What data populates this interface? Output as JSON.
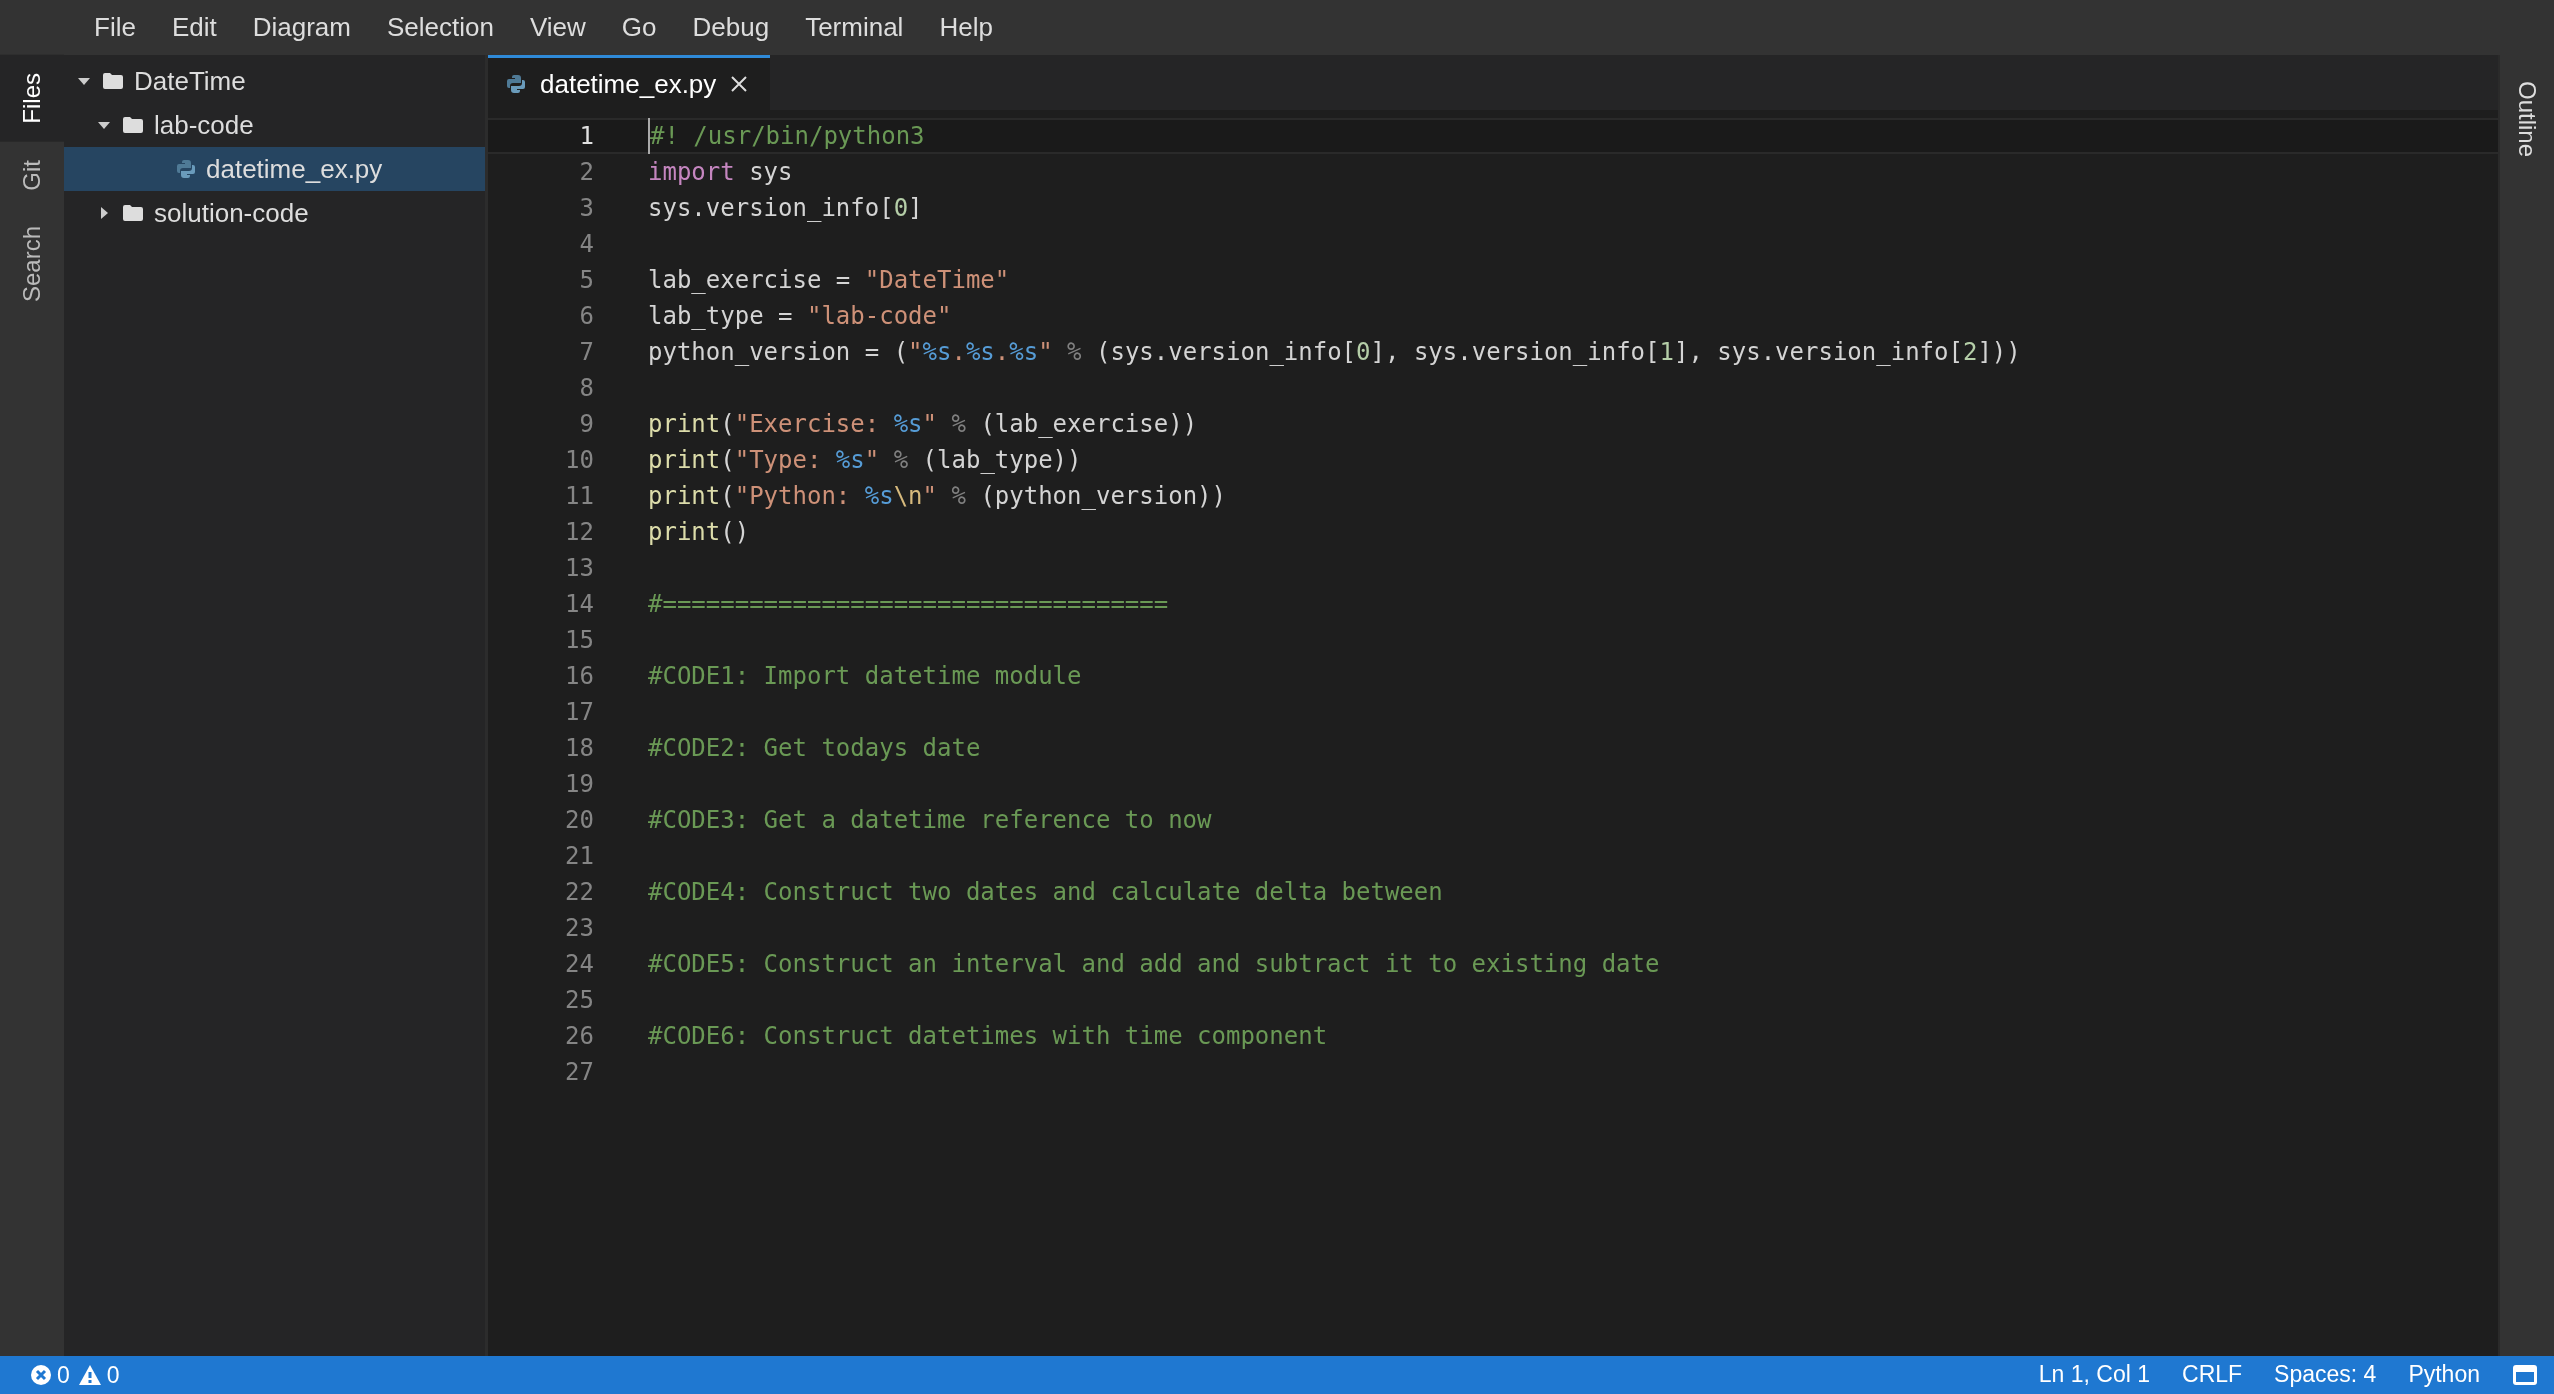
{
  "menu": [
    "File",
    "Edit",
    "Diagram",
    "Selection",
    "View",
    "Go",
    "Debug",
    "Terminal",
    "Help"
  ],
  "activity_tabs": [
    {
      "label": "Files",
      "selected": true
    },
    {
      "label": "Git",
      "selected": false
    },
    {
      "label": "Search",
      "selected": false
    }
  ],
  "tree": [
    {
      "label": "DateTime",
      "kind": "folder",
      "expanded": true,
      "selected": false,
      "children": [
        {
          "label": "lab-code",
          "kind": "folder",
          "expanded": true,
          "selected": false,
          "children": [
            {
              "label": "datetime_ex.py",
              "kind": "file",
              "selected": true
            }
          ]
        },
        {
          "label": "solution-code",
          "kind": "folder",
          "expanded": false,
          "selected": false
        }
      ]
    }
  ],
  "editor_tabs": [
    {
      "label": "datetime_ex.py",
      "selected": true
    }
  ],
  "code_lines": [
    {
      "number": "1",
      "current": true,
      "tokens": [
        {
          "text": "#! /usr/bin/python3",
          "kind": "comment"
        }
      ]
    },
    {
      "number": "2",
      "current": false,
      "tokens": [
        {
          "text": "import",
          "kind": "keyword"
        },
        {
          "text": " sys",
          "kind": "plain"
        }
      ]
    },
    {
      "number": "3",
      "current": false,
      "tokens": [
        {
          "text": "sys.version_info[",
          "kind": "plain"
        },
        {
          "text": "0",
          "kind": "number"
        },
        {
          "text": "]",
          "kind": "plain"
        }
      ]
    },
    {
      "number": "4",
      "current": false
    },
    {
      "number": "5",
      "current": false,
      "tokens": [
        {
          "text": "lab_exercise = ",
          "kind": "plain"
        },
        {
          "text": "\"DateTime\"",
          "kind": "string"
        }
      ]
    },
    {
      "number": "6",
      "current": false,
      "tokens": [
        {
          "text": "lab_type = ",
          "kind": "plain"
        },
        {
          "text": "\"lab-code\"",
          "kind": "string"
        }
      ]
    },
    {
      "number": "7",
      "current": false,
      "tokens": [
        {
          "text": "python_version = (",
          "kind": "plain"
        },
        {
          "text": "\"",
          "kind": "string"
        },
        {
          "text": "%s",
          "kind": "format"
        },
        {
          "text": ".",
          "kind": "string"
        },
        {
          "text": "%s",
          "kind": "format"
        },
        {
          "text": ".",
          "kind": "string"
        },
        {
          "text": "%s",
          "kind": "format"
        },
        {
          "text": "\"",
          "kind": "string"
        },
        {
          "text": " % ",
          "kind": "op"
        },
        {
          "text": "(sys.version_info[",
          "kind": "plain"
        },
        {
          "text": "0",
          "kind": "number"
        },
        {
          "text": "], sys.version_info[",
          "kind": "plain"
        },
        {
          "text": "1",
          "kind": "number"
        },
        {
          "text": "], sys.version_info[",
          "kind": "plain"
        },
        {
          "text": "2",
          "kind": "number"
        },
        {
          "text": "]))",
          "kind": "plain"
        }
      ]
    },
    {
      "number": "8",
      "current": false
    },
    {
      "number": "9",
      "current": false,
      "tokens": [
        {
          "text": "print",
          "kind": "func"
        },
        {
          "text": "(",
          "kind": "plain"
        },
        {
          "text": "\"Exercise: ",
          "kind": "string"
        },
        {
          "text": "%s",
          "kind": "format"
        },
        {
          "text": "\"",
          "kind": "string"
        },
        {
          "text": " % ",
          "kind": "op"
        },
        {
          "text": "(lab_exercise))",
          "kind": "plain"
        }
      ]
    },
    {
      "number": "10",
      "current": false,
      "tokens": [
        {
          "text": "print",
          "kind": "func"
        },
        {
          "text": "(",
          "kind": "plain"
        },
        {
          "text": "\"Type: ",
          "kind": "string"
        },
        {
          "text": "%s",
          "kind": "format"
        },
        {
          "text": "\"",
          "kind": "string"
        },
        {
          "text": " % ",
          "kind": "op"
        },
        {
          "text": "(lab_type))",
          "kind": "plain"
        }
      ]
    },
    {
      "number": "11",
      "current": false,
      "tokens": [
        {
          "text": "print",
          "kind": "func"
        },
        {
          "text": "(",
          "kind": "plain"
        },
        {
          "text": "\"Python: ",
          "kind": "string"
        },
        {
          "text": "%s",
          "kind": "format"
        },
        {
          "text": "\\n",
          "kind": "escape"
        },
        {
          "text": "\"",
          "kind": "string"
        },
        {
          "text": " % ",
          "kind": "op"
        },
        {
          "text": "(python_version))",
          "kind": "plain"
        }
      ]
    },
    {
      "number": "12",
      "current": false,
      "tokens": [
        {
          "text": "print",
          "kind": "func"
        },
        {
          "text": "()",
          "kind": "plain"
        }
      ]
    },
    {
      "number": "13",
      "current": false
    },
    {
      "number": "14",
      "current": false,
      "tokens": [
        {
          "text": "#===================================",
          "kind": "comment"
        }
      ]
    },
    {
      "number": "15",
      "current": false
    },
    {
      "number": "16",
      "current": false,
      "tokens": [
        {
          "text": "#CODE1: Import datetime module",
          "kind": "comment"
        }
      ]
    },
    {
      "number": "17",
      "current": false
    },
    {
      "number": "18",
      "current": false,
      "tokens": [
        {
          "text": "#CODE2: Get todays date",
          "kind": "comment"
        }
      ]
    },
    {
      "number": "19",
      "current": false
    },
    {
      "number": "20",
      "current": false,
      "tokens": [
        {
          "text": "#CODE3: Get a datetime reference to now",
          "kind": "comment"
        }
      ]
    },
    {
      "number": "21",
      "current": false
    },
    {
      "number": "22",
      "current": false,
      "tokens": [
        {
          "text": "#CODE4: Construct two dates and calculate delta between",
          "kind": "comment"
        }
      ]
    },
    {
      "number": "23",
      "current": false
    },
    {
      "number": "24",
      "current": false,
      "tokens": [
        {
          "text": "#CODE5: Construct an interval and add and subtract it to existing date",
          "kind": "comment"
        }
      ]
    },
    {
      "number": "25",
      "current": false
    },
    {
      "number": "26",
      "current": false,
      "tokens": [
        {
          "text": "#CODE6: Construct datetimes with time component",
          "kind": "comment"
        }
      ]
    },
    {
      "number": "27",
      "current": false
    }
  ],
  "right_panel": {
    "label": "Outline"
  },
  "status_bar": {
    "errors": "0",
    "warnings": "0",
    "items": [
      "Ln 1, Col 1",
      "CRLF",
      "Spaces: 4",
      "Python"
    ]
  }
}
